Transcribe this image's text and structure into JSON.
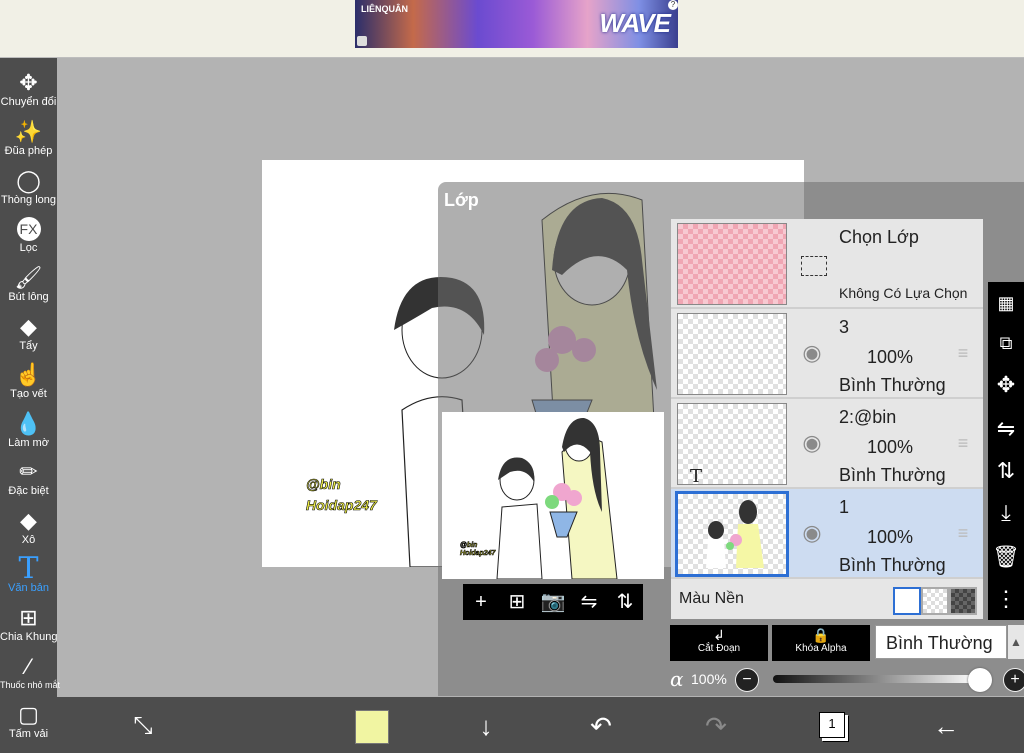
{
  "ad": {
    "brand": "LIÊNQUÂN",
    "wordmark": "WAVE",
    "close": "?"
  },
  "toolbar": {
    "tools": [
      {
        "label": "Chuyển đổi",
        "icon": "move-icon",
        "glyph": "✥"
      },
      {
        "label": "Đũa phép",
        "icon": "magic-wand-icon",
        "glyph": "✨"
      },
      {
        "label": "Thòng long",
        "icon": "lasso-icon",
        "glyph": "◯"
      },
      {
        "label": "Lọc",
        "icon": "fx-icon",
        "glyph": "FX"
      },
      {
        "label": "Bút lông",
        "icon": "brush-icon",
        "glyph": "🖌"
      },
      {
        "label": "Tẩy",
        "icon": "eraser-icon",
        "glyph": "◆"
      },
      {
        "label": "Tạo vết",
        "icon": "smudge-icon",
        "glyph": "☝"
      },
      {
        "label": "Làm mờ",
        "icon": "blur-icon",
        "glyph": "💧"
      },
      {
        "label": "Đặc biệt",
        "icon": "special-brush-icon",
        "glyph": "✏"
      },
      {
        "label": "Xô",
        "icon": "bucket-icon",
        "glyph": "◆"
      },
      {
        "label": "Văn bản",
        "icon": "text-icon",
        "glyph": "T"
      },
      {
        "label": "Chia Khung",
        "icon": "frame-divider-icon",
        "glyph": "⊞"
      },
      {
        "label": "Thuốc nhỏ mắt",
        "icon": "eyedropper-icon",
        "glyph": "⁄"
      },
      {
        "label": "Tấm vải",
        "icon": "canvas-icon",
        "glyph": "▢"
      }
    ],
    "active_tool": "Văn bản"
  },
  "canvas": {
    "watermark_1": "@bin",
    "watermark_2": "Hoidap247"
  },
  "layer_panel": {
    "title": "Lớp",
    "selection_layer": {
      "title": "Chọn Lớp",
      "status": "Không Có Lựa Chọn"
    },
    "layers": [
      {
        "name": "3",
        "opacity": "100%",
        "mode": "Bình Thường",
        "visible": true
      },
      {
        "name": "2:@bin",
        "opacity": "100%",
        "mode": "Bình Thường",
        "visible": true,
        "type_marker": "T"
      },
      {
        "name": "1",
        "opacity": "100%",
        "mode": "Bình Thường",
        "visible": true,
        "selected": true
      }
    ],
    "background_label": "Màu Nền",
    "clip_label": "Cắt Đoạn",
    "alpha_lock_label": "Khóa Alpha",
    "blend_mode": "Bình Thường",
    "alpha_symbol": "α",
    "alpha_value": "100%",
    "preview_buttons": [
      "+",
      "⊞",
      "📷",
      "⇋",
      "⇅"
    ],
    "preview_watermark_1": "@bin",
    "preview_watermark_2": "Hoidap247"
  },
  "bottom_bar": {
    "layer_count": "1",
    "current_color": "#f1f5a2"
  },
  "colors": {
    "accent": "#3aa0ff",
    "selected_layer": "#cddcf1",
    "toolbar": "#4d4d4d"
  }
}
